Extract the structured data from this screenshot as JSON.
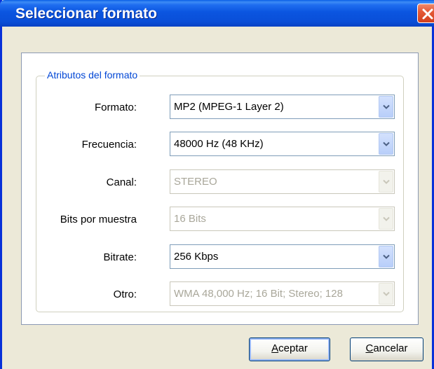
{
  "window": {
    "title": "Seleccionar formato",
    "close_icon": "close-icon"
  },
  "group": {
    "legend": "Atributos del formato"
  },
  "fields": [
    {
      "label": "Formato:",
      "value": "MP2 (MPEG-1 Layer 2)",
      "enabled": true
    },
    {
      "label": "Frecuencia:",
      "value": "48000 Hz (48 KHz)",
      "enabled": true
    },
    {
      "label": "Canal:",
      "value": "STEREO",
      "enabled": false
    },
    {
      "label": "Bits por muestra",
      "value": "16 Bits",
      "enabled": false
    },
    {
      "label": "Bitrate:",
      "value": "256 Kbps",
      "enabled": true
    },
    {
      "label": "Otro:",
      "value": "WMA 48,000 Hz; 16 Bit; Stereo; 128",
      "enabled": false
    }
  ],
  "buttons": {
    "accept_mnemonic": "A",
    "accept_rest": "ceptar",
    "cancel_mnemonic": "C",
    "cancel_rest": "ancelar"
  },
  "colors": {
    "titlebar": "#0a4fd8",
    "legend": "#0046d5",
    "disabled_text": "#a9a79a"
  }
}
